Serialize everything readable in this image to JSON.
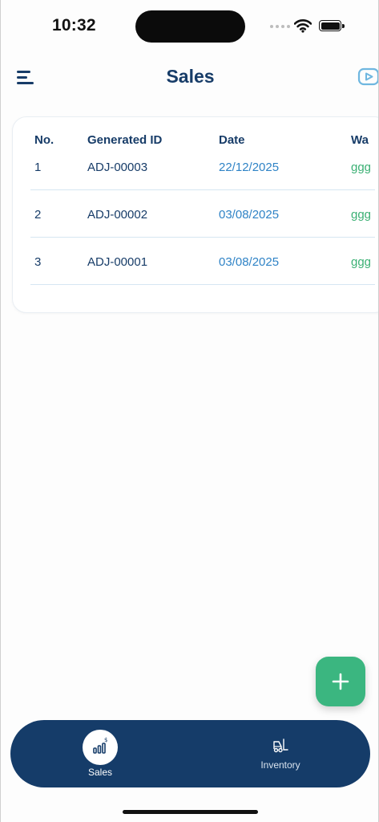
{
  "status_bar": {
    "time": "10:32"
  },
  "header": {
    "title": "Sales",
    "menu_icon": "hamburger-menu-icon",
    "video_icon": "video-play-icon"
  },
  "table": {
    "columns": [
      "No.",
      "Generated ID",
      "Date",
      "Wa"
    ],
    "rows": [
      {
        "no": "1",
        "id": "ADJ-00003",
        "date": "22/12/2025",
        "wa": "ggg"
      },
      {
        "no": "2",
        "id": "ADJ-00002",
        "date": "03/08/2025",
        "wa": "ggg"
      },
      {
        "no": "3",
        "id": "ADJ-00001",
        "date": "03/08/2025",
        "wa": "ggg"
      }
    ]
  },
  "fab": {
    "icon": "plus-icon"
  },
  "bottom_nav": {
    "items": [
      {
        "label": "Sales",
        "icon": "sales-chart-icon",
        "active": true
      },
      {
        "label": "Inventory",
        "icon": "forklift-icon",
        "active": false
      }
    ]
  },
  "colors": {
    "primary": "#153c69",
    "accent_green": "#3bb680",
    "date_blue": "#2f83c6",
    "divider": "#d6e6f2"
  }
}
